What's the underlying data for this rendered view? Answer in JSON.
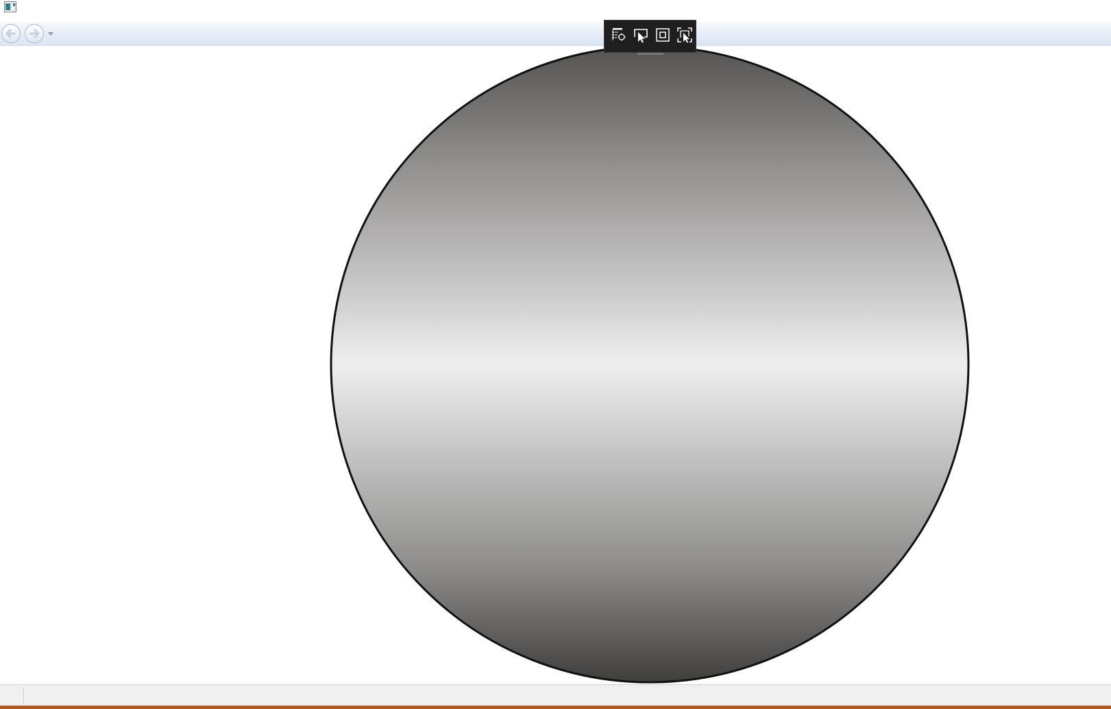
{
  "window": {
    "icon": "app-window-icon",
    "title": ""
  },
  "navigation": {
    "back_icon": "arrow-left-icon",
    "forward_icon": "arrow-right-icon",
    "history_icon": "chevron-down-icon"
  },
  "debug_toolbar": {
    "tools": [
      {
        "name": "live-visual-tree-icon"
      },
      {
        "name": "select-element-icon"
      },
      {
        "name": "display-layout-adorners-icon"
      },
      {
        "name": "track-focused-element-icon"
      }
    ]
  },
  "canvas": {
    "shape": "circle",
    "fill_stops": [
      "#555352",
      "#8a8887",
      "#c4c3c3",
      "#eeeeee",
      "#c4c4c4",
      "#8d8c8b",
      "#3f3e3d"
    ],
    "stroke_color": "#111111"
  },
  "status_bar": {
    "text": ""
  },
  "colors": {
    "nav_bar": "#dbe4f3",
    "toolbar_bg": "#1f1f1f",
    "accent": "#b4541e"
  }
}
